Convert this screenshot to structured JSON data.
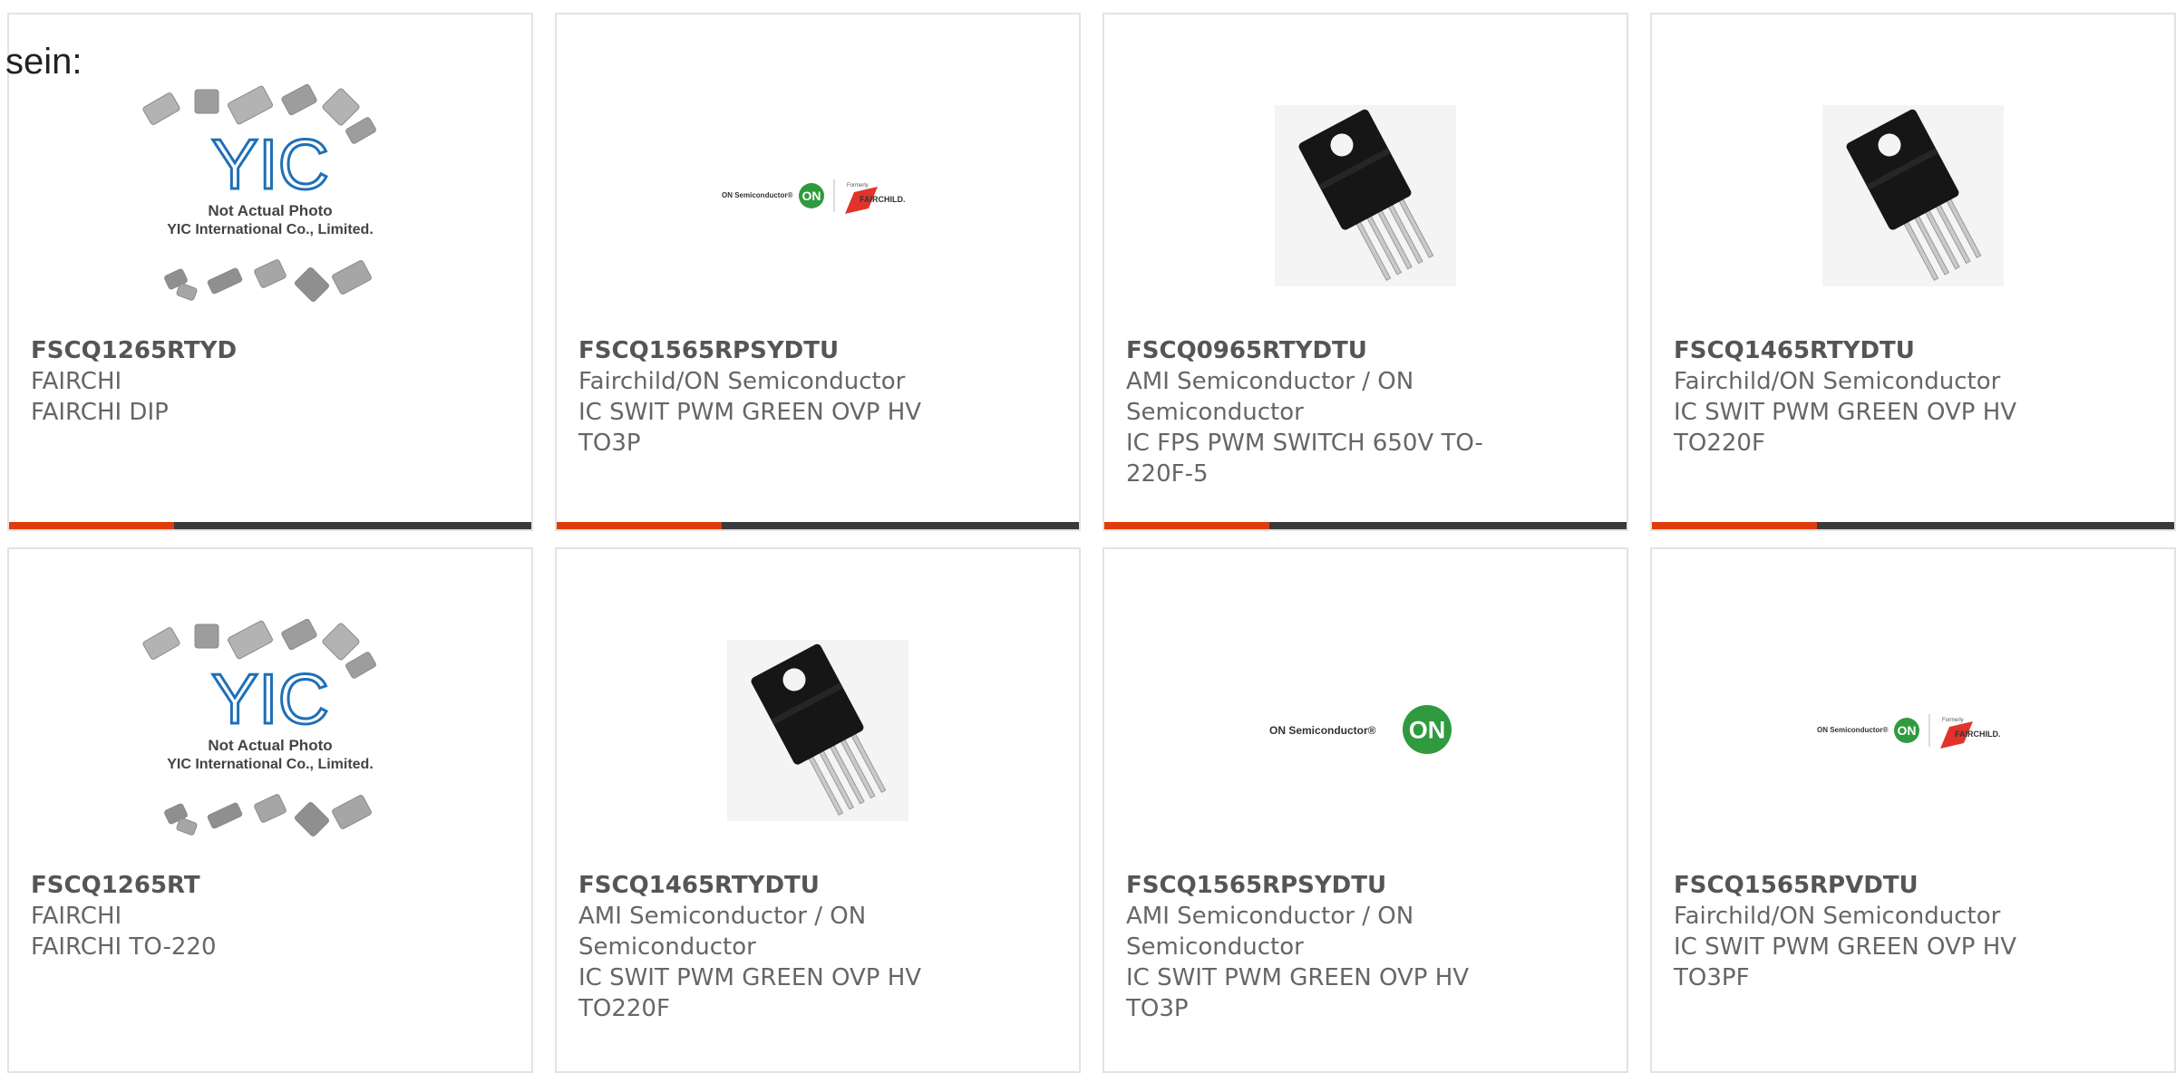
{
  "intro_text": "sein:",
  "placeholder_photo": {
    "logo_text": "YIC",
    "caption_line1": "Not Actual Photo",
    "caption_line2": "YIC International Co., Limited."
  },
  "on_logo": {
    "small_text": "ON Semiconductor®",
    "badge": "ON",
    "formerly": "Formerly",
    "fairchild": "FAIRCHILD."
  },
  "products": [
    {
      "part": "FSCQ1265RTYD",
      "lines": [
        "FAIRCHI",
        "FAIRCHI DIP"
      ],
      "image": "placeholder"
    },
    {
      "part": "FSCQ1565RPSYDTU",
      "lines": [
        "Fairchild/ON Semiconductor",
        "IC SWIT PWM GREEN OVP HV",
        "TO3P"
      ],
      "image": "on-fairchild-logo"
    },
    {
      "part": "FSCQ0965RTYDTU",
      "lines": [
        "AMI Semiconductor / ON",
        "Semiconductor",
        "IC FPS PWM SWITCH 650V TO-",
        "220F-5"
      ],
      "image": "to220-package"
    },
    {
      "part": "FSCQ1465RTYDTU",
      "lines": [
        "Fairchild/ON Semiconductor",
        "IC SWIT PWM GREEN OVP HV",
        "TO220F"
      ],
      "image": "to220-package"
    },
    {
      "part": "FSCQ1265RT",
      "lines": [
        "FAIRCHI",
        "FAIRCHI TO-220"
      ],
      "image": "placeholder"
    },
    {
      "part": "FSCQ1465RTYDTU",
      "lines": [
        "AMI Semiconductor / ON",
        "Semiconductor",
        "IC SWIT PWM GREEN OVP HV",
        "TO220F"
      ],
      "image": "to220-package"
    },
    {
      "part": "FSCQ1565RPSYDTU",
      "lines": [
        "AMI Semiconductor / ON",
        "Semiconductor",
        "IC SWIT PWM GREEN OVP HV",
        "TO3P"
      ],
      "image": "on-logo"
    },
    {
      "part": "FSCQ1565RPVDTU",
      "lines": [
        "Fairchild/ON Semiconductor",
        "IC SWIT PWM GREEN OVP HV",
        "TO3PF"
      ],
      "image": "on-fairchild-logo"
    }
  ],
  "colors": {
    "accent": "#e03c0c",
    "bar": "#3a3a3a",
    "border": "#e3e3e3",
    "yic_blue": "#1f6fb8",
    "on_green": "#2f9a3e",
    "fairchild_red": "#e2332a"
  }
}
